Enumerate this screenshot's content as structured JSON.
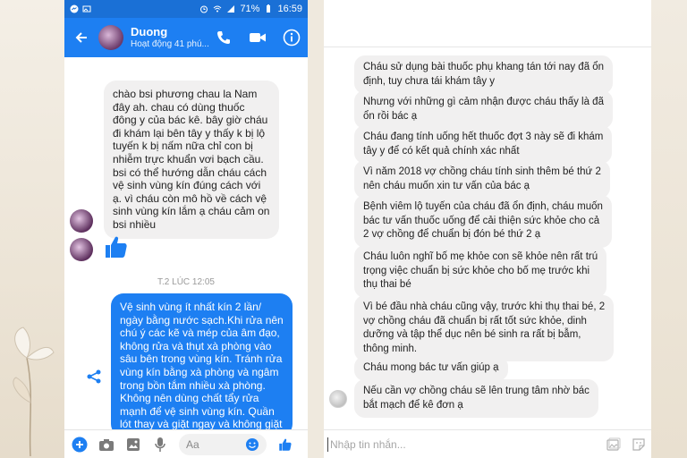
{
  "phone": {
    "status": {
      "battery": "71%",
      "time": "16:59"
    },
    "header": {
      "name": "Duong",
      "subtitle": "Hoạt động 41 phú..."
    },
    "incoming_lines": [
      "chào bsi phương chau la Nam",
      "đây ah. chau có dùng thuốc",
      "đông y của bác kê. bây giờ cháu",
      "đi khám lại bên tây y thấy k bị lộ",
      "tuyến k bị nấm nữa chỉ con bị",
      "nhiễm trực khuẩn vơi bạch cầu.",
      "bsi có thể hướng dẫn cháu cách",
      "vệ sinh vùng kín đúng cách với",
      "ạ. vì cháu còn mô hồ về cách vệ",
      "sinh vùng kín lắm ạ cháu cảm on",
      "bsi nhiều"
    ],
    "timestamp": "T.2 LÚC 12:05",
    "outgoing_lines": [
      "Vệ sinh vùng ít nhất kín 2 lần/",
      "ngày bằng nước sạch.Khi rửa nên",
      "chú ý các kẽ và mép của âm đạo,",
      "không rửa và thụt xà phòng vào",
      "sâu bên trong vùng kín. Tránh rửa",
      "vùng kín bằng xà phòng và ngâm",
      "trong bồn tắm nhiều xà phòng.",
      "Không nên dùng chất tẩy rửa",
      "mạnh để vệ sinh vùng kín. Quần",
      "lót thay và giặt ngay và không giặt"
    ],
    "composer_placeholder": "Aa"
  },
  "chat": {
    "messages": [
      {
        "lines": [
          "Cháu sử dụng bài thuốc phụ khang tán tới nay đã ổn",
          "định, tuy chưa tái khám tây y"
        ]
      },
      {
        "lines": [
          "Nhưng với những gì cảm nhận được cháu thấy là đã",
          "ổn rồi bác ạ"
        ]
      },
      {
        "lines": [
          "Cháu đang tính uống hết thuốc đợt 3 này sẽ đi khám",
          "tây y để có kết quả chính xác nhất"
        ]
      },
      {
        "lines": [
          "Vì năm 2018 vợ chồng cháu tính sinh thêm bé thứ 2",
          "nên cháu muốn xin tư vấn của bác ạ"
        ]
      },
      {
        "lines": [
          "Bệnh viêm lộ tuyến của cháu đã ổn định, cháu muốn",
          "bác tư vấn thuốc uống để cải thiện sức khỏe cho cả",
          "2 vợ chồng để chuẩn bị đón bé thứ 2 ạ"
        ]
      },
      {
        "lines": [
          "Cháu luôn nghĩ bố mẹ khỏe con sẽ khỏe nên rất trú",
          "trọng việc chuẩn bị sức khỏe cho bố mẹ trước khi",
          "thụ thai bé"
        ]
      },
      {
        "lines": [
          "Vì bé đầu nhà cháu cũng vậy, trước khi thụ thai bé, 2",
          "vợ chồng cháu đã chuẩn bị rất tốt sức khỏe, dinh",
          "dưỡng và tập thể dục nên bé sinh ra rất bị bẫm,",
          "thông minh."
        ]
      },
      {
        "lines": [
          "Cháu mong bác tư vấn giúp ạ"
        ]
      },
      {
        "lines": [
          "Nếu cần vợ chồng cháu sẽ lên trung tâm nhờ bác",
          "bắt mạch để kê đơn ạ"
        ]
      }
    ],
    "input_placeholder": "Nhập tin nhắn..."
  },
  "colors": {
    "messenger_blue": "#1d7ff2",
    "status_blue": "#1a70d6",
    "bubble_gray": "#f1f0f0"
  },
  "icons": [
    "back-arrow-icon",
    "phone-icon",
    "video-icon",
    "info-icon",
    "thumbs-up-icon",
    "share-icon",
    "plus-icon",
    "camera-icon",
    "image-icon",
    "microphone-icon",
    "emoji-icon",
    "sticker-icon"
  ]
}
